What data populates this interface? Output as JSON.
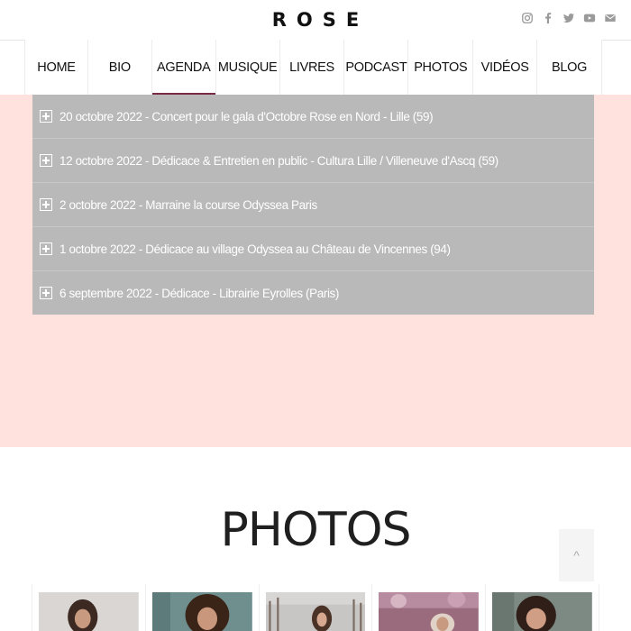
{
  "site": {
    "logo": "ROSE"
  },
  "social": [
    "instagram-icon",
    "facebook-icon",
    "twitter-icon",
    "youtube-icon",
    "mail-icon"
  ],
  "nav": {
    "items": [
      {
        "label": "HOME"
      },
      {
        "label": "BIO"
      },
      {
        "label": "AGENDA",
        "active": true
      },
      {
        "label": "MUSIQUE"
      },
      {
        "label": "LIVRES"
      },
      {
        "label": "PODCAST"
      },
      {
        "label": "PHOTOS"
      },
      {
        "label": "VIDÉOS"
      },
      {
        "label": "BLOG"
      }
    ]
  },
  "agenda": {
    "items": [
      {
        "text": "20 octobre 2022 - Concert pour le gala d'Octobre Rose en Nord - Lille (59)"
      },
      {
        "text": "12 octobre 2022 - Dédicace & Entretien en public - Cultura Lille / Villeneuve d'Ascq (59)"
      },
      {
        "text": "2 octobre 2022 - Marraine la course Odyssea Paris"
      },
      {
        "text": "1 octobre 2022 - Dédicace au village Odyssea au Château de Vincennes (94)"
      },
      {
        "text": "6 septembre 2022 - Dédicace - Librairie Eyrolles (Paris)"
      }
    ]
  },
  "photos": {
    "title": "PHOTOS"
  },
  "scroll_top": {
    "glyph": "^"
  },
  "colors": {
    "accent": "#7b2a44",
    "pink_band": "#ffe1de",
    "accordion": "#b9b9b9"
  }
}
